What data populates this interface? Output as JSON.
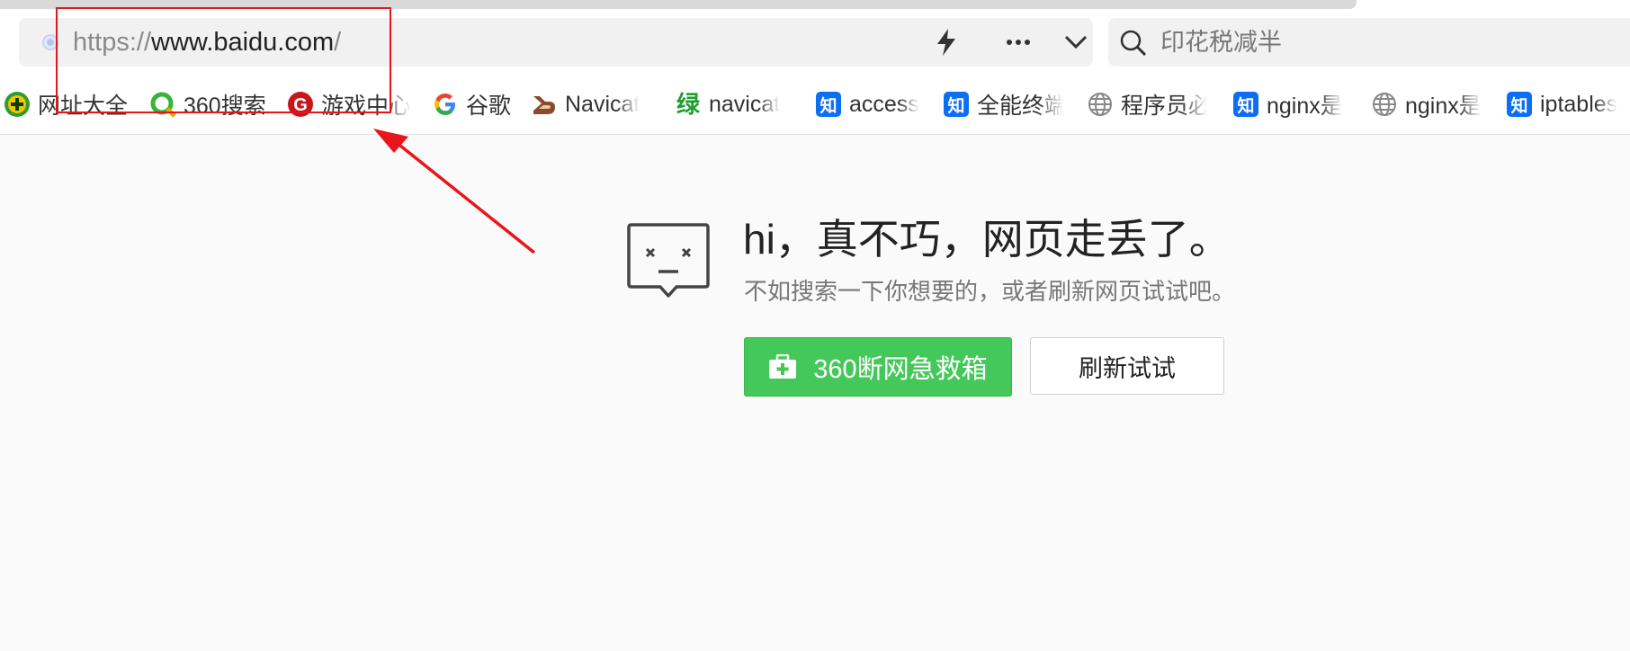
{
  "browser": {
    "address_bar": {
      "url_scheme": "https://",
      "url_host": "www.baidu.com",
      "url_tail": "/"
    },
    "search": {
      "text": "印花税减半"
    },
    "bookmarks": [
      {
        "label": "网址大全",
        "icon": "plus-circle-icon"
      },
      {
        "label": "360搜索",
        "icon": "360-search-icon"
      },
      {
        "label": "游戏中心",
        "icon": "game-center-icon"
      },
      {
        "label": "谷歌",
        "icon": "google-icon"
      },
      {
        "label": "Navicat",
        "icon": "navicat-icon"
      },
      {
        "label": "navicat",
        "icon": "green-glyph-icon",
        "glyph": "绿"
      },
      {
        "label": "access",
        "icon": "zhihu-icon",
        "glyph": "知"
      },
      {
        "label": "全能终端",
        "icon": "zhihu-icon",
        "glyph": "知"
      },
      {
        "label": "程序员必",
        "icon": "globe-icon"
      },
      {
        "label": "nginx是",
        "icon": "zhihu-icon",
        "glyph": "知"
      },
      {
        "label": "nginx是",
        "icon": "globe-icon"
      },
      {
        "label": "iptables",
        "icon": "zhihu-icon",
        "glyph": "知"
      }
    ]
  },
  "error_page": {
    "title": "hi，真不巧，网页走丢了。",
    "subtitle": "不如搜索一下你想要的，或者刷新网页试试吧。",
    "primary_button": "360断网急救箱",
    "secondary_button": "刷新试试"
  },
  "colors": {
    "accent_green": "#45c85a",
    "annotation_red": "#e8161b",
    "zhihu_blue": "#0b6ef5"
  }
}
